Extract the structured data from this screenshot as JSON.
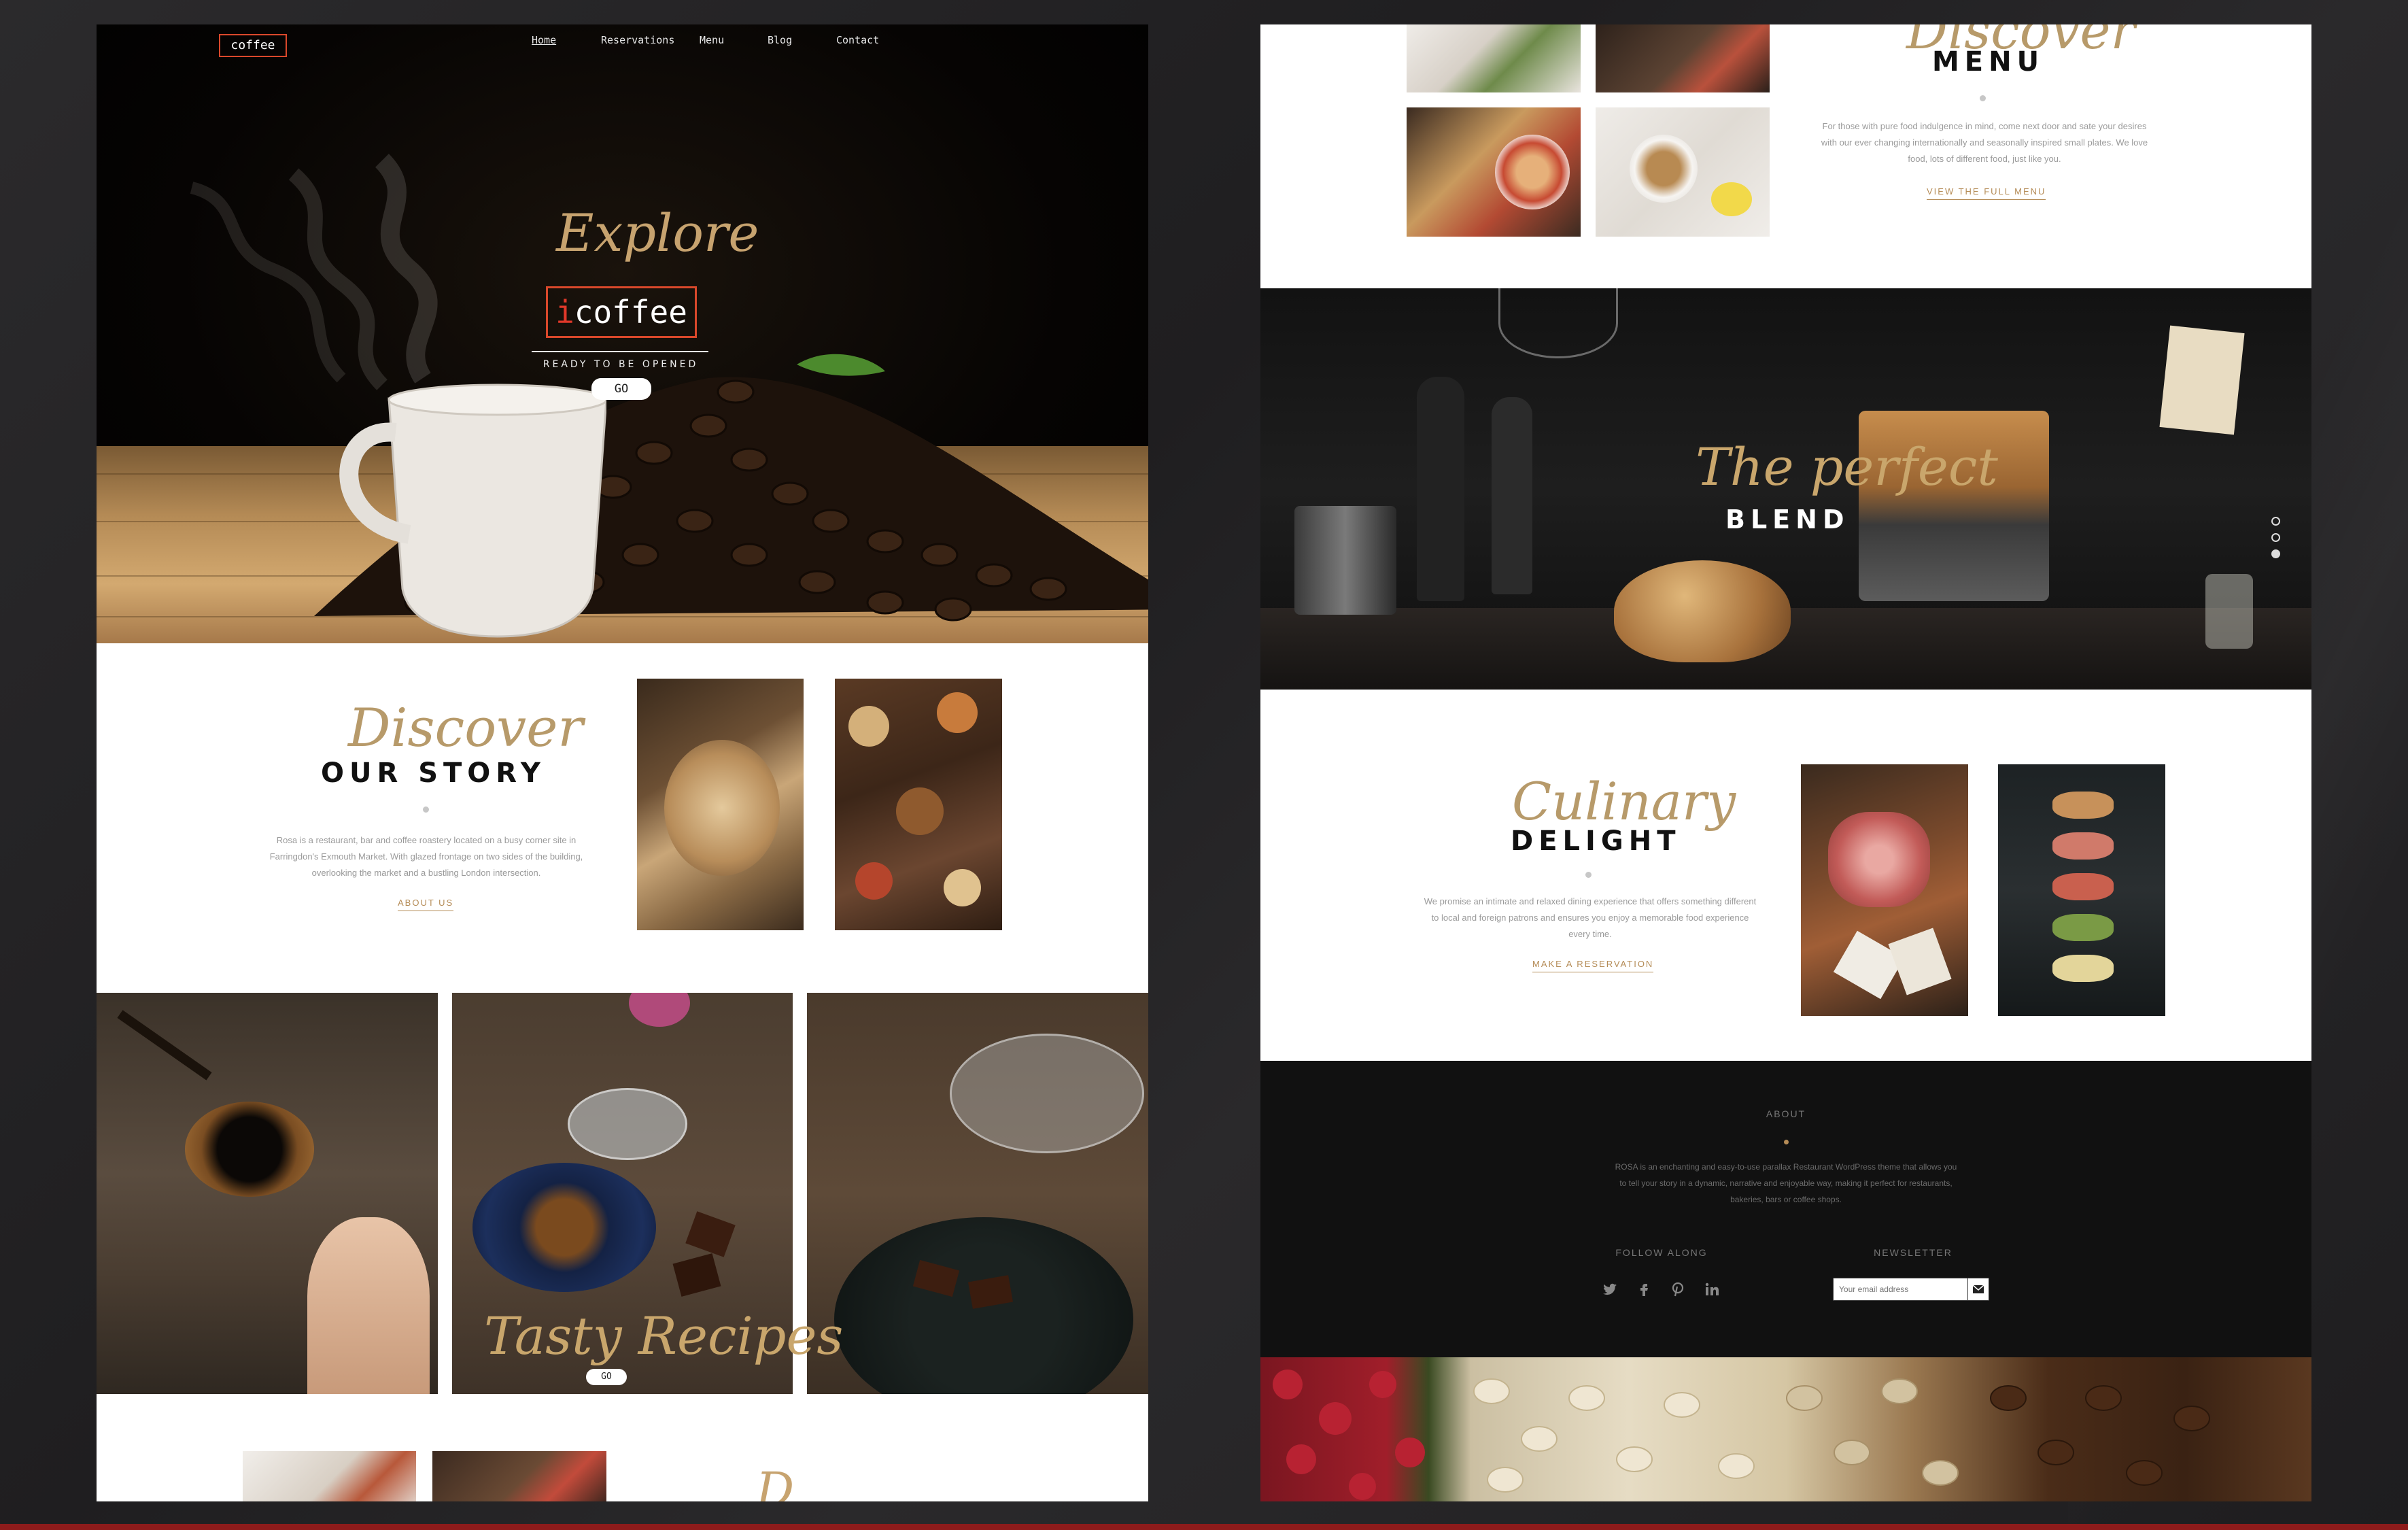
{
  "left": {
    "nav": {
      "logo": "coffee",
      "items": [
        "Home",
        "Reservations",
        "Menu",
        "Blog",
        "Contact"
      ]
    },
    "hero": {
      "script": "Explore",
      "brand_mark": "i",
      "brand": "coffee",
      "tagline": "READY TO BE OPENED",
      "go_label": "GO"
    },
    "story": {
      "script": "Discover",
      "heading": "OUR STORY",
      "body": "Rosa is a restaurant, bar and coffee roastery located on a busy corner site in Farringdon's Exmouth Market. With glazed frontage on two sides of the building, overlooking the market and a bustling London intersection.",
      "link": "ABOUT US"
    },
    "recipes": {
      "script": "Tasty Recipes",
      "go_label": "GO"
    }
  },
  "right": {
    "menu": {
      "script": "Discover",
      "heading": "MENU",
      "body": "For those with pure food indulgence in mind, come next door and sate your desires with our ever changing internationally and seasonally inspired small plates. We love food, lots of different food, just like you.",
      "link": "VIEW THE FULL MENU"
    },
    "blend": {
      "script": "The perfect",
      "heading": "BLEND"
    },
    "delight": {
      "script": "Culinary",
      "heading": "DELIGHT",
      "body": "We promise an intimate and relaxed dining experience that offers something different to local and foreign patrons and ensures you enjoy a memorable food experience every time.",
      "link": "MAKE A RESERVATION"
    },
    "footer": {
      "about_title": "ABOUT",
      "about_body": "ROSA is an enchanting and easy-to-use parallax Restaurant WordPress theme that allows you to tell your story in a dynamic, narrative and enjoyable way, making it perfect for restaurants, bakeries, bars or coffee shops.",
      "follow_title": "FOLLOW ALONG",
      "newsletter_title": "NEWSLETTER",
      "newsletter_placeholder": "Your email address",
      "social": [
        "twitter-icon",
        "facebook-icon",
        "pinterest-icon",
        "linkedin-icon"
      ]
    }
  },
  "colors": {
    "accent_gold": "#b58c57",
    "logo_red": "#d9482b",
    "backdrop": "#252426"
  }
}
